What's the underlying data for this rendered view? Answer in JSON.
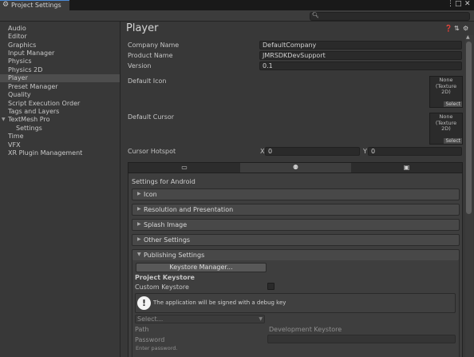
{
  "window": {
    "tab_title": "Project Settings",
    "search_placeholder": ""
  },
  "sidebar": {
    "items": [
      {
        "label": "Audio"
      },
      {
        "label": "Editor"
      },
      {
        "label": "Graphics"
      },
      {
        "label": "Input Manager"
      },
      {
        "label": "Physics"
      },
      {
        "label": "Physics 2D"
      },
      {
        "label": "Player",
        "selected": true
      },
      {
        "label": "Preset Manager"
      },
      {
        "label": "Quality"
      },
      {
        "label": "Script Execution Order"
      },
      {
        "label": "Tags and Layers"
      },
      {
        "label": "TextMesh Pro",
        "expanded": true
      },
      {
        "label": "Settings"
      },
      {
        "label": "Time"
      },
      {
        "label": "VFX"
      },
      {
        "label": "XR Plugin Management"
      }
    ]
  },
  "player": {
    "title": "Player",
    "company_name_label": "Company Name",
    "company_name_value": "DefaultCompany",
    "product_name_label": "Product Name",
    "product_name_value": "JMRSDKDevSupport",
    "version_label": "Version",
    "version_value": "0.1",
    "default_icon_label": "Default Icon",
    "default_cursor_label": "Default Cursor",
    "texture_none": "None",
    "texture_type": "(Texture 2D)",
    "select_label": "Select",
    "cursor_hotspot_label": "Cursor Hotspot",
    "hotspot_x_label": "X",
    "hotspot_x_value": "0",
    "hotspot_y_label": "Y",
    "hotspot_y_value": "0"
  },
  "platform": {
    "settings_for": "Settings for Android",
    "sections": [
      {
        "label": "Icon"
      },
      {
        "label": "Resolution and Presentation"
      },
      {
        "label": "Splash Image"
      },
      {
        "label": "Other Settings"
      },
      {
        "label": "Publishing Settings"
      }
    ]
  },
  "publishing": {
    "keystore_manager": "Keystore Manager...",
    "project_keystore": "Project Keystore",
    "custom_keystore": "Custom Keystore",
    "custom_keystore_checked": false,
    "help_text": "The application will be signed with a debug key",
    "select_placeholder": "Select...",
    "path_label": "Path",
    "path_value": "Development Keystore",
    "password_label": "Password",
    "password_placeholder": "Enter password."
  },
  "colors": {
    "background": "#383838",
    "field": "#2a2a2a",
    "selected": "#4d4d4d",
    "accent": "#4a8ad6"
  }
}
